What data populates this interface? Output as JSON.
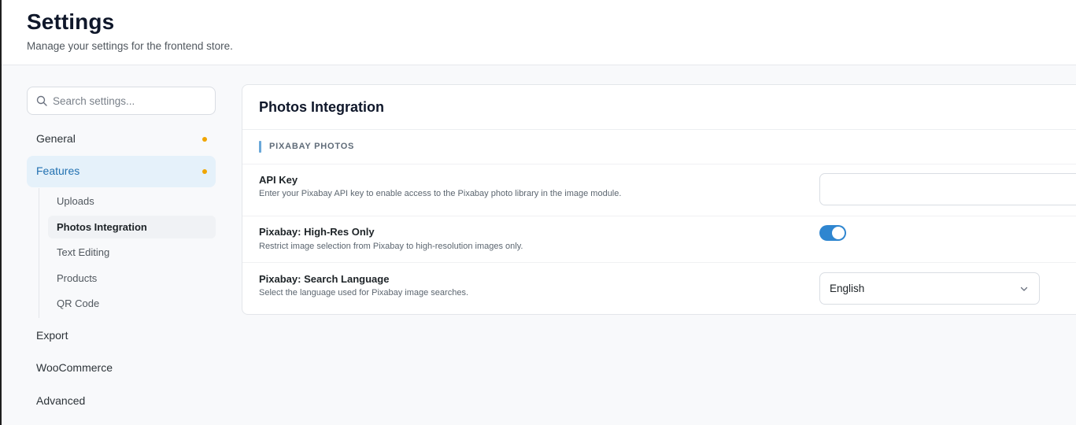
{
  "header": {
    "title": "Settings",
    "subtitle": "Manage your settings for the frontend store."
  },
  "sidebar": {
    "search_placeholder": "Search settings...",
    "items": [
      {
        "label": "General",
        "has_dot": true
      },
      {
        "label": "Features",
        "has_dot": true,
        "active": true
      },
      {
        "label": "Export"
      },
      {
        "label": "WooCommerce"
      },
      {
        "label": "Advanced"
      }
    ],
    "subitems": [
      {
        "label": "Uploads"
      },
      {
        "label": "Photos Integration",
        "active": true
      },
      {
        "label": "Text Editing"
      },
      {
        "label": "Products"
      },
      {
        "label": "QR Code"
      }
    ]
  },
  "panel": {
    "title": "Photos Integration",
    "section_title": "PIXABAY PHOTOS",
    "rows": [
      {
        "label": "API Key",
        "description": "Enter your Pixabay API key to enable access to the Pixabay photo library in the image module.",
        "value": ""
      },
      {
        "label": "Pixabay: High-Res Only",
        "description": "Restrict image selection from Pixabay to high-resolution images only.",
        "enabled": true
      },
      {
        "label": "Pixabay: Search Language",
        "description": "Select the language used for Pixabay image searches.",
        "selected": "English"
      }
    ]
  },
  "colors": {
    "accent": "#2271b1",
    "toggle_on": "#2f86d0",
    "dot": "#f0a500",
    "active_bg": "#e5f1fa"
  },
  "icons": {
    "search": "search-icon",
    "chevron": "chevron-down-icon"
  }
}
